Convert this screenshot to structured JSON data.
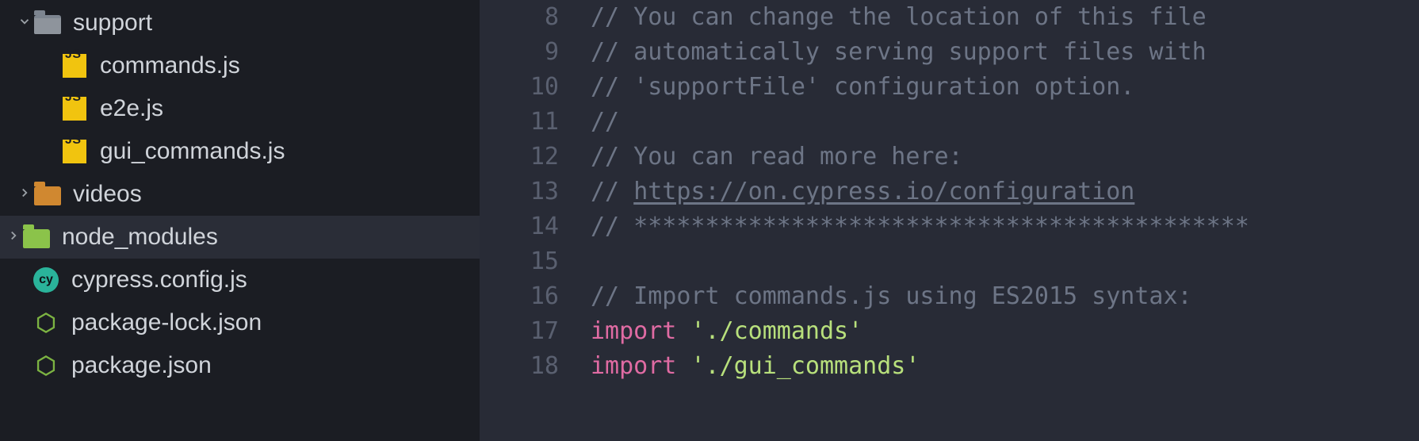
{
  "sidebar": {
    "items": [
      {
        "kind": "folder",
        "name": "support",
        "expanded": true,
        "indent": 0,
        "icon": "folder-open"
      },
      {
        "kind": "file",
        "name": "commands.js",
        "indent": 1,
        "icon": "js"
      },
      {
        "kind": "file",
        "name": "e2e.js",
        "indent": 1,
        "icon": "js"
      },
      {
        "kind": "file",
        "name": "gui_commands.js",
        "indent": 1,
        "icon": "js"
      },
      {
        "kind": "folder",
        "name": "videos",
        "expanded": false,
        "indent": 0,
        "icon": "folder-orange",
        "chev": true
      },
      {
        "kind": "folder",
        "name": "node_modules",
        "expanded": false,
        "indent": -1,
        "icon": "folder-green",
        "chev": true,
        "highlight": true
      },
      {
        "kind": "file",
        "name": "cypress.config.js",
        "indent": 0,
        "icon": "cypress"
      },
      {
        "kind": "file",
        "name": "package-lock.json",
        "indent": 0,
        "icon": "node"
      },
      {
        "kind": "file",
        "name": "package.json",
        "indent": 0,
        "icon": "node"
      }
    ]
  },
  "editor": {
    "lines": [
      {
        "n": 8,
        "seg": [
          {
            "t": "// You can change the location of this file",
            "c": "comment"
          }
        ]
      },
      {
        "n": 9,
        "seg": [
          {
            "t": "// automatically serving support files with",
            "c": "comment"
          }
        ]
      },
      {
        "n": 10,
        "seg": [
          {
            "t": "// 'supportFile' configuration option.",
            "c": "comment"
          }
        ]
      },
      {
        "n": 11,
        "seg": [
          {
            "t": "//",
            "c": "comment"
          }
        ]
      },
      {
        "n": 12,
        "seg": [
          {
            "t": "// You can read more here:",
            "c": "comment"
          }
        ]
      },
      {
        "n": 13,
        "seg": [
          {
            "t": "// ",
            "c": "comment"
          },
          {
            "t": "https://on.cypress.io/configuration",
            "c": "link"
          }
        ]
      },
      {
        "n": 14,
        "seg": [
          {
            "t": "// *******************************************",
            "c": "comment"
          }
        ]
      },
      {
        "n": 15,
        "seg": [
          {
            "t": "",
            "c": "plain"
          }
        ]
      },
      {
        "n": 16,
        "seg": [
          {
            "t": "// Import commands.js using ES2015 syntax:",
            "c": "comment"
          }
        ]
      },
      {
        "n": 17,
        "seg": [
          {
            "t": "import",
            "c": "keyword"
          },
          {
            "t": " ",
            "c": "plain"
          },
          {
            "t": "'./commands'",
            "c": "string"
          }
        ]
      },
      {
        "n": 18,
        "seg": [
          {
            "t": "import",
            "c": "keyword"
          },
          {
            "t": " ",
            "c": "plain"
          },
          {
            "t": "'./gui_commands'",
            "c": "string"
          }
        ]
      }
    ]
  },
  "icon_labels": {
    "js": "JS",
    "cy": "cy"
  }
}
